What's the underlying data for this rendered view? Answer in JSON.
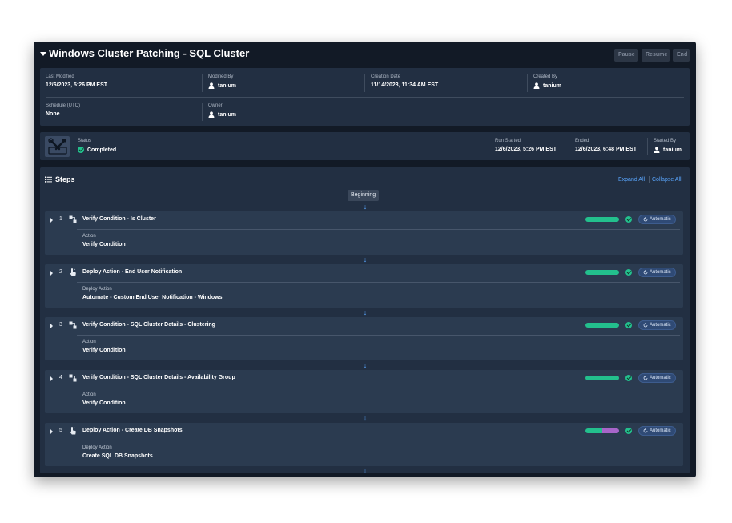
{
  "header": {
    "title": "Windows Cluster Patching - SQL Cluster",
    "buttons": {
      "pause": "Pause",
      "resume": "Resume",
      "end": "End"
    }
  },
  "info": {
    "last_modified": {
      "label": "Last Modified",
      "value": "12/6/2023, 5:26 PM EST"
    },
    "modified_by": {
      "label": "Modified By",
      "value": "tanium"
    },
    "creation_date": {
      "label": "Creation Date",
      "value": "11/14/2023, 11:34 AM EST"
    },
    "created_by": {
      "label": "Created By",
      "value": "tanium"
    },
    "schedule": {
      "label": "Schedule (UTC)",
      "value": "None"
    },
    "owner": {
      "label": "Owner",
      "value": "tanium"
    }
  },
  "status": {
    "label": "Status",
    "value": "Completed",
    "run_started": {
      "label": "Run Started",
      "value": "12/6/2023, 5:26 PM EST"
    },
    "ended": {
      "label": "Ended",
      "value": "12/6/2023, 6:48 PM EST"
    },
    "started_by": {
      "label": "Started By",
      "value": "tanium"
    }
  },
  "steps_section": {
    "title": "Steps",
    "expand_all": "Expand All",
    "collapse_all": "Collapse All",
    "beginning": "Beginning"
  },
  "steps": [
    {
      "number": "1",
      "icon": "condition-icon",
      "title": "Verify Condition - Is Cluster",
      "sub_label": "Action",
      "sub_value": "Verify Condition",
      "badge": "Automatic",
      "progress": {
        "green": 1.0,
        "purple": 0.0
      }
    },
    {
      "number": "2",
      "icon": "hand-pointer-icon",
      "title": "Deploy Action - End User Notification",
      "sub_label": "Deploy Action",
      "sub_value": "Automate - Custom End User Notification - Windows",
      "badge": "Automatic",
      "progress": {
        "green": 1.0,
        "purple": 0.0
      }
    },
    {
      "number": "3",
      "icon": "condition-icon",
      "title": "Verify Condition - SQL Cluster Details - Clustering",
      "sub_label": "Action",
      "sub_value": "Verify Condition",
      "badge": "Automatic",
      "progress": {
        "green": 1.0,
        "purple": 0.0
      }
    },
    {
      "number": "4",
      "icon": "condition-icon",
      "title": "Verify Condition - SQL Cluster Details - Availability Group",
      "sub_label": "Action",
      "sub_value": "Verify Condition",
      "badge": "Automatic",
      "progress": {
        "green": 1.0,
        "purple": 0.0
      }
    },
    {
      "number": "5",
      "icon": "hand-pointer-icon",
      "title": "Deploy Action - Create DB Snapshots",
      "sub_label": "Deploy Action",
      "sub_value": "Create SQL DB Snapshots",
      "badge": "Automatic",
      "progress": {
        "green": 0.5,
        "purple": 0.5
      }
    }
  ],
  "colors": {
    "success": "#23c08d",
    "accent_link": "#5aa7ff",
    "partial": "#a765c9",
    "badge_bg": "#2f4a75"
  }
}
